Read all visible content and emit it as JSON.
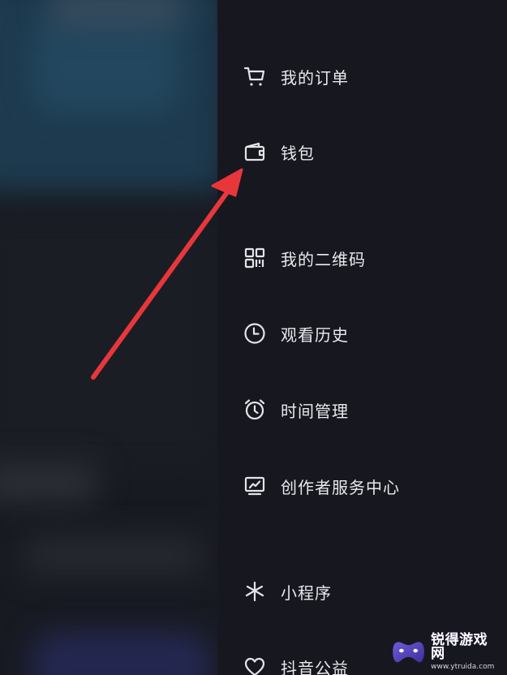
{
  "menu": {
    "items": [
      {
        "id": "orders",
        "label": "我的订单",
        "icon": "cart-icon"
      },
      {
        "id": "wallet",
        "label": "钱包",
        "icon": "wallet-icon"
      },
      {
        "id": "qrcode",
        "label": "我的二维码",
        "icon": "qr-code-icon"
      },
      {
        "id": "history",
        "label": "观看历史",
        "icon": "clock-icon"
      },
      {
        "id": "time",
        "label": "时间管理",
        "icon": "alarm-clock-icon"
      },
      {
        "id": "creator",
        "label": "创作者服务中心",
        "icon": "creator-chart-icon"
      },
      {
        "id": "mini",
        "label": "小程序",
        "icon": "mini-program-icon"
      },
      {
        "id": "charity",
        "label": "抖音公益",
        "icon": "heart-icon"
      }
    ]
  },
  "annotation": {
    "type": "arrow",
    "color": "#e8373a",
    "points_to": "wallet"
  },
  "watermark": {
    "title": "锐得游戏网",
    "url": "www.ytruida.com"
  },
  "colors": {
    "drawer_bg": "#17181f",
    "menu_text": "#e9e9ec",
    "icon": "#e4e4e8"
  }
}
